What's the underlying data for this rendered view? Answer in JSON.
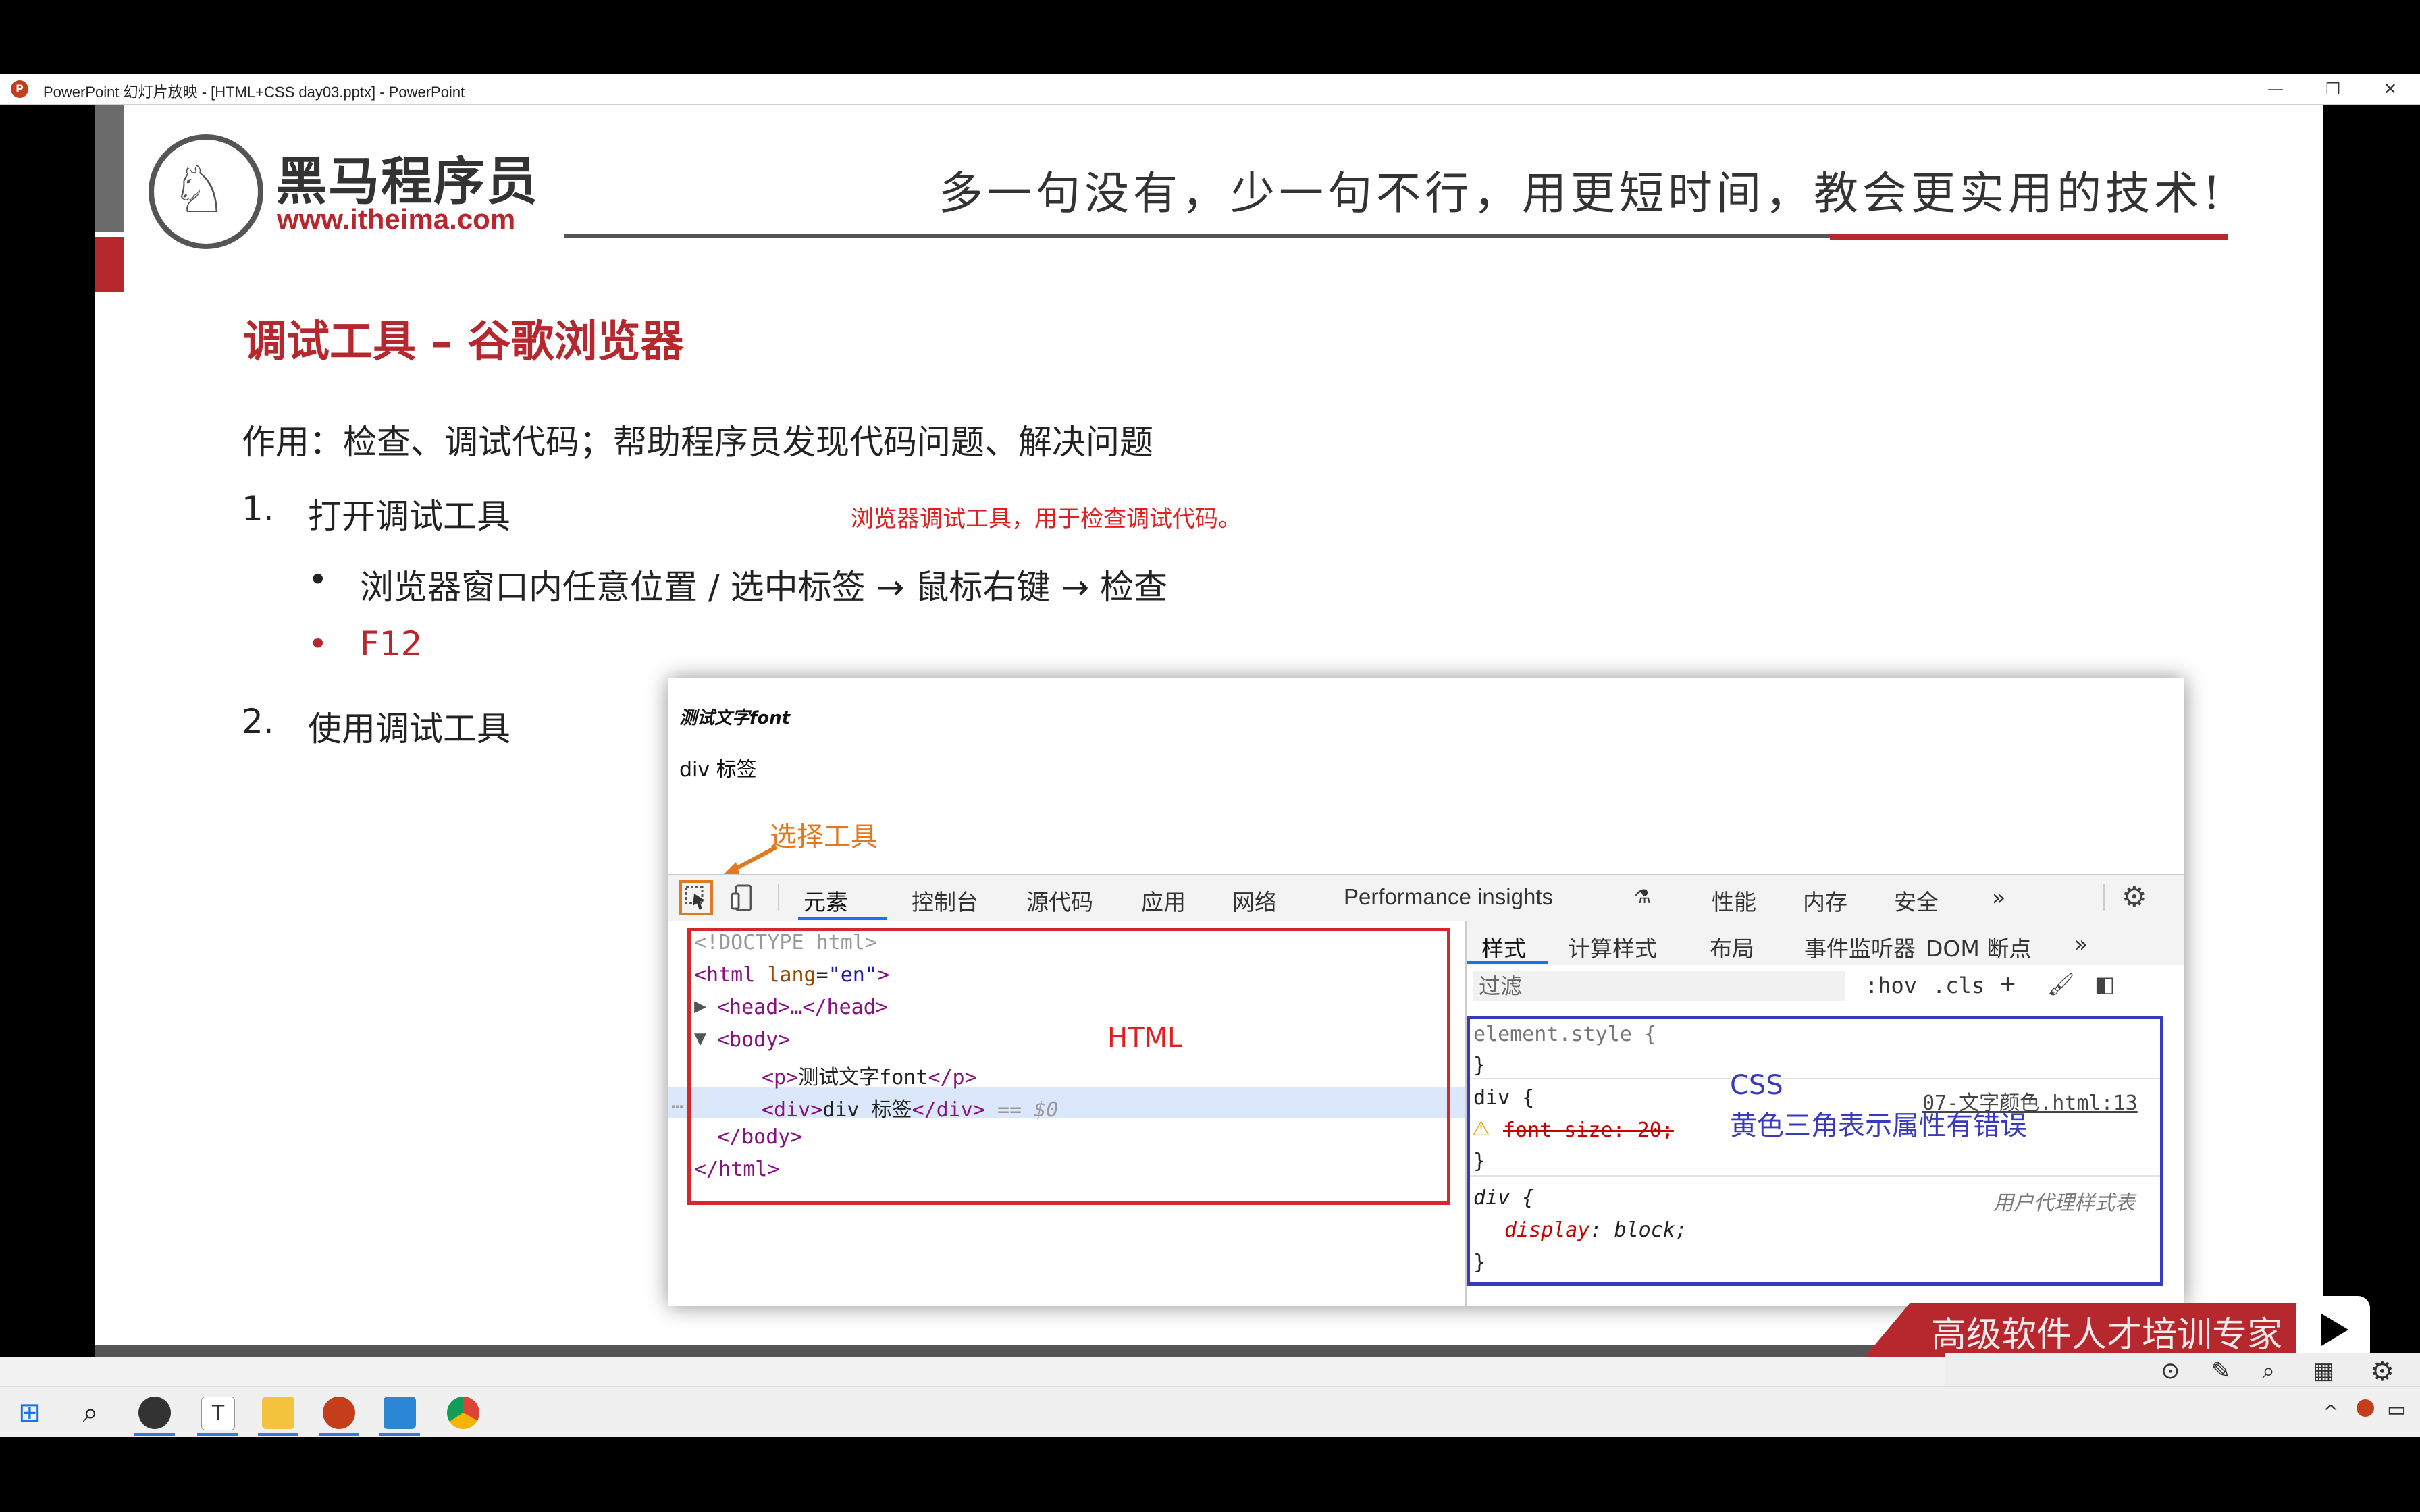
{
  "window": {
    "title": "PowerPoint 幻灯片放映 - [HTML+CSS day03.pptx] - PowerPoint",
    "minimize": "—",
    "restore": "❐",
    "close": "✕"
  },
  "slide": {
    "logo_cn": "黑马程序员",
    "logo_url": "www.itheima.com",
    "slogan": "多一句没有，少一句不行，用更短时间，教会更实用的技术!",
    "heading": "调试工具 – 谷歌浏览器",
    "purpose": "作用：检查、调试代码；帮助程序员发现代码问题、解决问题",
    "step1_num": "1.",
    "step1_label": "打开调试工具",
    "red_note": "浏览器调试工具，用于检查调试代码。",
    "bullet_dot": "•",
    "bullet1": "浏览器窗口内任意位置 / 选中标签 → 鼠标右键 → 检查",
    "bullet2": "F12",
    "step2_num": "2.",
    "step2_label": "使用调试工具",
    "banner": "高级软件人才培训专家"
  },
  "devtools": {
    "page_p": "测试文字font",
    "page_div": "div 标签",
    "select_tool_label": "选择工具",
    "tabs": [
      "元素",
      "控制台",
      "源代码",
      "应用",
      "网络",
      "Performance insights",
      "性能",
      "内存",
      "安全",
      "»"
    ],
    "code": {
      "doctype": "<!DOCTYPE html>",
      "html_open_tag": "<html ",
      "html_attr": "lang",
      "html_eq": "=",
      "html_val": "\"en\"",
      "html_close_bracket": ">",
      "head": "<head>…</head>",
      "body_open": "<body>",
      "p_open": "<p>",
      "p_text": "测试文字font",
      "p_close": "</p>",
      "div_open": "<div>",
      "div_text": "div 标签",
      "div_close": "</div>",
      "div_ref": " == $0",
      "body_close": "</body>",
      "html_close": "</html>",
      "more": "…"
    },
    "html_label": "HTML",
    "styles_tabs": [
      "样式",
      "计算样式",
      "布局",
      "事件监听器",
      "DOM 断点",
      "»"
    ],
    "filter_placeholder": "过滤",
    "hov": ":hov",
    "cls": ".cls",
    "plus": "+",
    "css": {
      "element_style": "element.style {",
      "close_brace": "}",
      "div_selector": "div {",
      "source_link": "07-文字颜色.html:13",
      "font_size_decl": "font-size: 20;",
      "user_agent": "用户代理样式表",
      "display_prop": "display",
      "display_val": ": block;"
    },
    "css_label": "CSS",
    "css_desc": "黄色三角表示属性有错误"
  },
  "taskbar": {
    "items": [
      "start",
      "search",
      "obs",
      "typora",
      "explorer",
      "powerpoint",
      "vscode",
      "chrome"
    ]
  },
  "colors": {
    "brand_red": "#b7282e",
    "highlight_orange": "#e07a20",
    "html_box": "#d62828",
    "css_box": "#3a3abf"
  }
}
